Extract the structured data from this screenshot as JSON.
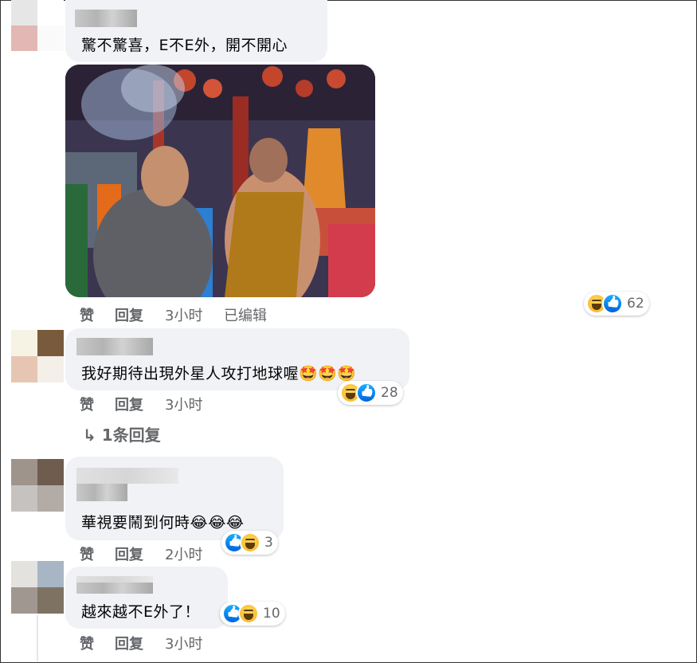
{
  "comments": [
    {
      "text": "驚不驚喜，E不E外，開不開心",
      "actions": {
        "like": "赞",
        "reply": "回复",
        "time": "3小时",
        "edited": "已编辑"
      },
      "reactions": {
        "icons": [
          "haha-icon",
          "like-icon"
        ],
        "count": "62"
      },
      "has_photo": true
    },
    {
      "text": "我好期待出現外星人攻打地球喔",
      "emoji": "🤩🤩🤩",
      "actions": {
        "like": "赞",
        "reply": "回复",
        "time": "3小时"
      },
      "reactions": {
        "icons": [
          "haha-icon",
          "like-icon"
        ],
        "count": "28"
      },
      "replies_link": "1条回复"
    },
    {
      "text": "華視要鬧到何時",
      "emoji": "😂😂😂",
      "actions": {
        "like": "赞",
        "reply": "回复",
        "time": "2小时"
      },
      "reactions": {
        "icons": [
          "like-icon",
          "haha-icon"
        ],
        "count": "3"
      }
    },
    {
      "text": "越來越不E外了！",
      "actions": {
        "like": "赞",
        "reply": "回复",
        "time": "3小时"
      },
      "reactions": {
        "icons": [
          "like-icon",
          "haha-icon"
        ],
        "count": "10"
      }
    }
  ],
  "colors": {
    "bubble": "#f0f2f5",
    "meta_text": "#65676b",
    "like_blue": "#0866ff",
    "haha_yellow": "#f7b125"
  }
}
